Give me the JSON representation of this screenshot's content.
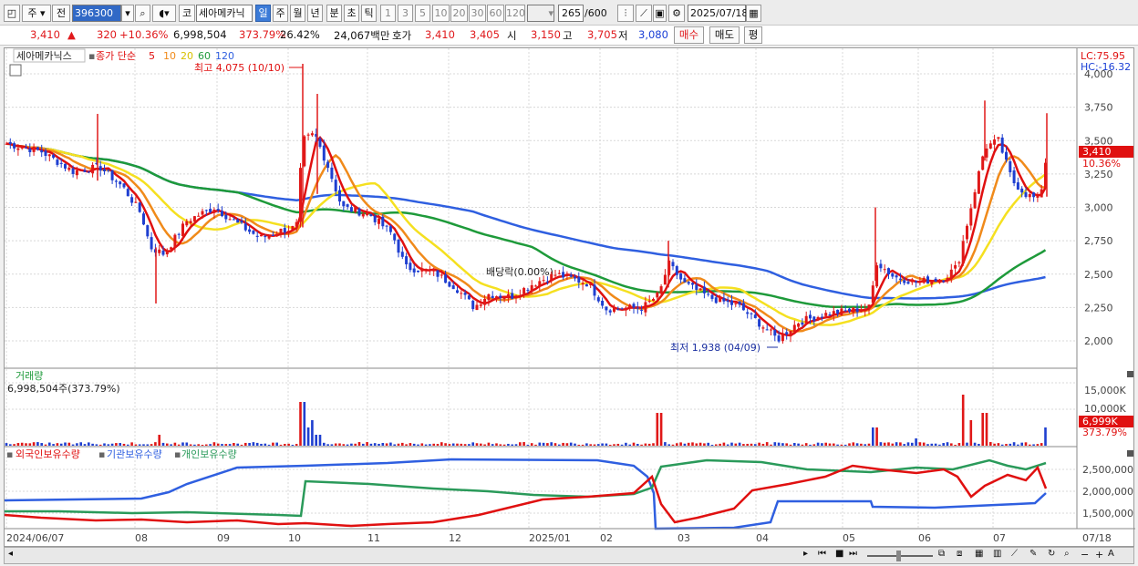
{
  "toolbar": {
    "market_toggle": "주",
    "prev_label": "전",
    "code": "396300",
    "corp_prefix": "코",
    "stock_name": "세아메카닉",
    "periods": [
      "일",
      "주",
      "월",
      "년",
      "분",
      "초",
      "틱"
    ],
    "active_period": "일",
    "intervals": [
      "1",
      "3",
      "5",
      "10",
      "20",
      "30",
      "60",
      "120"
    ],
    "count": "265",
    "count_max": "/600",
    "date": "2025/07/18"
  },
  "quote": {
    "price": "3,410",
    "arrow": "▲",
    "change": "320",
    "change_pct": "+10.36%",
    "volume": "6,998,504",
    "volume_ratio": "373.79%",
    "turnover": "26.42%",
    "amount": "24,067백만",
    "ask_label": "호가",
    "ask1": "3,410",
    "ask2": "3,405",
    "open_label": "시",
    "open": "3,150",
    "high_label": "고",
    "high": "3,705",
    "low_label": "저",
    "low": "3,080",
    "buy_label": "매수",
    "sell_label": "매도",
    "eval_label": "평"
  },
  "price_panel": {
    "name": "세아메카닉스",
    "ma_label": "종가 단순",
    "ma_periods": [
      "5",
      "10",
      "20",
      "60",
      "120"
    ],
    "high_note": "최고 4,075 (10/10)",
    "low_note": "최저 1,938 (04/09)",
    "dividend_note": "배당락(0.00%)",
    "lc": "LC:75.95",
    "hc": "HC:-16.32",
    "current_price": "3,410",
    "current_pct": "10.36%",
    "y_ticks": [
      "4,000",
      "3,750",
      "3,500",
      "3,250",
      "3,000",
      "2,750",
      "2,500",
      "2,250",
      "2,000"
    ]
  },
  "volume_panel": {
    "title": "거래량",
    "value": "6,998,504주(373.79%)",
    "y_ticks": [
      "15,000K",
      "10,000K"
    ],
    "current": "6,999K",
    "current_pct": "373.79%"
  },
  "holding_panel": {
    "legend": [
      "외국인보유수량",
      "기관보유수량",
      "개인보유수량"
    ],
    "y_ticks": [
      "2,500,000",
      "2,000,000",
      "1,500,000"
    ]
  },
  "x_axis": [
    "2024/06/07",
    "08",
    "09",
    "10",
    "11",
    "12",
    "2025/01",
    "02",
    "03",
    "04",
    "05",
    "06",
    "07"
  ],
  "x_end": "07/18",
  "colors": {
    "ma5": "#e01010",
    "ma10": "#f08a1a",
    "ma20": "#f5e020",
    "ma60": "#1e9a3a",
    "ma120": "#2f5fe0",
    "up": "#e01818",
    "down": "#1f3fd0",
    "foreign": "#e01010",
    "institution": "#2f5fe0",
    "individual": "#2a9a5a"
  }
}
